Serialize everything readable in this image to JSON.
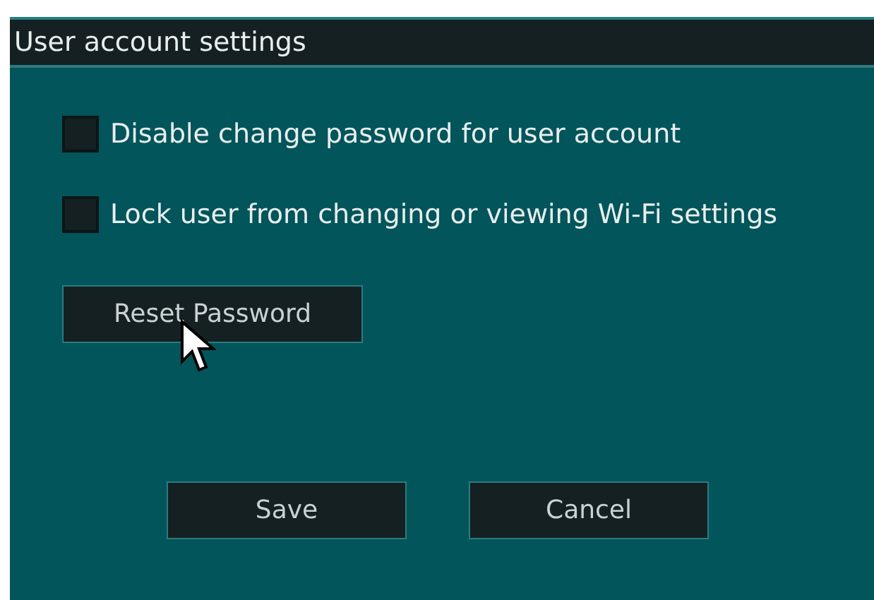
{
  "window": {
    "title": "User account settings"
  },
  "options": [
    {
      "label": "Disable change password for user account",
      "checked": false
    },
    {
      "label": "Lock user from changing or viewing Wi-Fi settings",
      "checked": false
    }
  ],
  "reset_button": "Reset Password",
  "buttons": [
    "Save",
    "Cancel"
  ]
}
